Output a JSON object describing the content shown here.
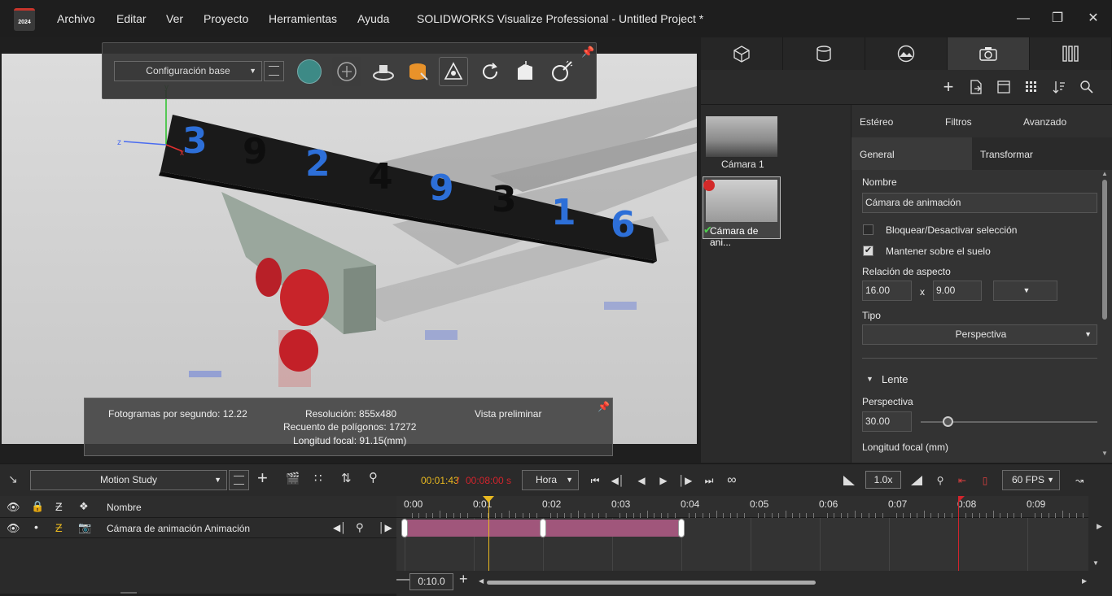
{
  "titlebar": {
    "logo_text": "2024",
    "menus": [
      "Archivo",
      "Editar",
      "Ver",
      "Proyecto",
      "Herramientas",
      "Ayuda"
    ],
    "title": "SOLIDWORKS Visualize Professional - Untitled Project *"
  },
  "toolbar": {
    "configuration": "Configuración base"
  },
  "stats": {
    "fps": "Fotogramas por segundo: 12.22",
    "resolution": "Resolución: 855x480",
    "polygons": "Recuento de polígonos: 17272",
    "focal": "Longitud focal: 91.15(mm)",
    "mode": "Vista preliminar"
  },
  "cameras": [
    {
      "label": "Cámara 1"
    },
    {
      "label": "Cámara de ani..."
    }
  ],
  "props": {
    "tabs_top": [
      "Estéreo",
      "Filtros",
      "Avanzado"
    ],
    "tabs_bottom": [
      "General",
      "Transformar"
    ],
    "name_label": "Nombre",
    "name_value": "Cámara de animación",
    "lock_label": "Bloquear/Desactivar selección",
    "ground_label": "Mantener sobre el suelo",
    "aspect_label": "Relación de aspecto",
    "aspect_w": "16.00",
    "aspect_x": "x",
    "aspect_h": "9.00",
    "type_label": "Tipo",
    "type_value": "Perspectiva",
    "lens_label": "Lente",
    "perspective_label": "Perspectiva",
    "perspective_value": "30.00",
    "perspective_slider_fraction": 0.15,
    "focal_label": "Longitud focal (mm)"
  },
  "timeline": {
    "study": "Motion Study",
    "current_time": "00:01:43",
    "separator": " / ",
    "total_time": "00:08:00 s",
    "unit": "Hora",
    "speed": "1.0x",
    "fps": "60 FPS",
    "header_name": "Nombre",
    "track_name": "Cámara de animación Animación",
    "ticks": [
      "0:00",
      "0:01",
      "0:02",
      "0:03",
      "0:04",
      "0:05",
      "0:06",
      "0:07",
      "0:08",
      "0:09"
    ],
    "zoom": "0:10.0",
    "playhead_seconds": 1.43,
    "end_marker_seconds": 8.0,
    "clip_start_seconds": 0,
    "clip_end_seconds": 4.0,
    "keyframes_seconds": [
      0,
      2,
      4
    ]
  },
  "colors": {
    "accent": "#2f9c3a",
    "clip": "#a0567b",
    "playhead": "#e8b820",
    "end_marker": "#d2242c",
    "blue_digits": "#2d6fd8",
    "red_digits": "#c8242a"
  }
}
